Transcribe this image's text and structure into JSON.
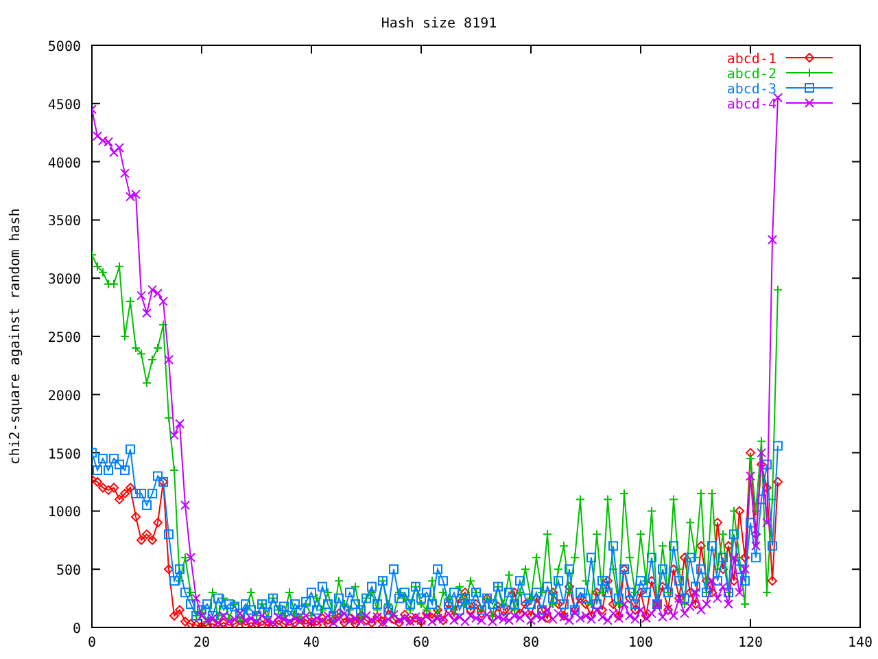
{
  "chart_data": {
    "type": "line",
    "title": "Hash size 8191",
    "ylabel": "chi2-square against random hash",
    "xlim": [
      0,
      140
    ],
    "ylim": [
      0,
      5000
    ],
    "xticks": [
      0,
      20,
      40,
      60,
      80,
      100,
      120,
      140
    ],
    "legend": true,
    "x": [
      0,
      1,
      2,
      3,
      4,
      5,
      6,
      7,
      8,
      9,
      10,
      11,
      12,
      13,
      14,
      15,
      16,
      17,
      18,
      19,
      20,
      21,
      22,
      23,
      24,
      25,
      26,
      27,
      28,
      29,
      30,
      31,
      32,
      33,
      34,
      35,
      36,
      37,
      38,
      39,
      40,
      41,
      42,
      43,
      44,
      45,
      46,
      47,
      48,
      49,
      50,
      51,
      52,
      53,
      54,
      55,
      56,
      57,
      58,
      59,
      60,
      61,
      62,
      63,
      64,
      65,
      66,
      67,
      68,
      69,
      70,
      71,
      72,
      73,
      74,
      75,
      76,
      77,
      78,
      79,
      80,
      81,
      82,
      83,
      84,
      85,
      86,
      87,
      88,
      89,
      90,
      91,
      92,
      93,
      94,
      95,
      96,
      97,
      98,
      99,
      100,
      101,
      102,
      103,
      104,
      105,
      106,
      107,
      108,
      109,
      110,
      111,
      112,
      113,
      114,
      115,
      116,
      117,
      118,
      119,
      120,
      121,
      122,
      123,
      124,
      125
    ],
    "yticks": [
      0,
      500,
      1000,
      1500,
      2000,
      2500,
      3000,
      3500,
      4000,
      4500,
      5000
    ],
    "series": [
      {
        "name": "abcd-1",
        "color": "#ff0000",
        "marker": "diamond",
        "values": [
          1270,
          1250,
          1200,
          1180,
          1200,
          1100,
          1150,
          1200,
          950,
          750,
          800,
          750,
          900,
          1250,
          500,
          100,
          150,
          50,
          30,
          20,
          10,
          20,
          30,
          10,
          40,
          20,
          30,
          60,
          20,
          40,
          30,
          20,
          50,
          10,
          60,
          30,
          20,
          40,
          70,
          30,
          50,
          20,
          80,
          30,
          60,
          120,
          40,
          80,
          30,
          100,
          60,
          40,
          90,
          50,
          150,
          70,
          40,
          110,
          60,
          80,
          50,
          120,
          80,
          150,
          60,
          200,
          100,
          250,
          300,
          150,
          200,
          120,
          250,
          80,
          180,
          100,
          150,
          300,
          120,
          200,
          100,
          250,
          150,
          80,
          300,
          200,
          100,
          350,
          150,
          250,
          200,
          100,
          300,
          150,
          400,
          200,
          100,
          500,
          250,
          150,
          300,
          100,
          400,
          200,
          350,
          150,
          500,
          250,
          600,
          300,
          200,
          700,
          400,
          300,
          900,
          500,
          700,
          400,
          1000,
          600,
          1500,
          800,
          1400,
          1200,
          400,
          1250
        ]
      },
      {
        "name": "abcd-2",
        "color": "#00c000",
        "marker": "plus",
        "values": [
          3200,
          3100,
          3050,
          2950,
          2950,
          3100,
          2500,
          2800,
          2400,
          2350,
          2100,
          2300,
          2400,
          2600,
          1800,
          1350,
          400,
          600,
          300,
          100,
          150,
          50,
          300,
          100,
          250,
          80,
          200,
          60,
          150,
          300,
          100,
          200,
          80,
          250,
          150,
          100,
          300,
          120,
          80,
          200,
          100,
          250,
          150,
          300,
          100,
          400,
          200,
          150,
          350,
          100,
          250,
          300,
          150,
          400,
          200,
          100,
          300,
          250,
          150,
          350,
          200,
          150,
          400,
          100,
          300,
          250,
          150,
          350,
          200,
          400,
          300,
          150,
          250,
          100,
          350,
          200,
          450,
          150,
          300,
          500,
          250,
          600,
          300,
          800,
          200,
          500,
          700,
          300,
          600,
          1100,
          400,
          200,
          800,
          300,
          1100,
          500,
          200,
          1150,
          600,
          300,
          800,
          400,
          1000,
          200,
          700,
          300,
          1100,
          500,
          200,
          900,
          600,
          1150,
          300,
          1150,
          500,
          800,
          300,
          1000,
          600,
          200,
          1450,
          1000,
          1600,
          300,
          1100,
          2900
        ]
      },
      {
        "name": "abcd-3",
        "color": "#0080ff",
        "marker": "square",
        "values": [
          1500,
          1350,
          1450,
          1350,
          1450,
          1400,
          1350,
          1530,
          1150,
          1150,
          1050,
          1150,
          1300,
          1250,
          800,
          400,
          500,
          300,
          200,
          100,
          150,
          200,
          100,
          250,
          150,
          200,
          180,
          120,
          200,
          150,
          100,
          200,
          130,
          250,
          150,
          180,
          100,
          200,
          150,
          220,
          300,
          150,
          350,
          200,
          100,
          250,
          150,
          300,
          200,
          150,
          250,
          350,
          200,
          400,
          150,
          500,
          250,
          300,
          200,
          350,
          250,
          300,
          200,
          500,
          400,
          200,
          300,
          150,
          250,
          200,
          300,
          150,
          250,
          200,
          350,
          150,
          300,
          200,
          400,
          250,
          200,
          300,
          150,
          350,
          250,
          400,
          200,
          500,
          150,
          300,
          250,
          600,
          200,
          400,
          300,
          700,
          250,
          500,
          300,
          200,
          400,
          300,
          600,
          200,
          500,
          300,
          700,
          400,
          250,
          600,
          350,
          500,
          300,
          700,
          400,
          600,
          300,
          800,
          500,
          400,
          900,
          600,
          1100,
          1400,
          700,
          1560
        ]
      },
      {
        "name": "abcd-4",
        "color": "#c000ff",
        "marker": "cross",
        "values": [
          4450,
          4220,
          4180,
          4170,
          4080,
          4120,
          3900,
          3700,
          3720,
          2850,
          2700,
          2900,
          2870,
          2800,
          2300,
          1650,
          1750,
          1050,
          600,
          250,
          100,
          60,
          80,
          40,
          100,
          50,
          70,
          120,
          60,
          80,
          50,
          100,
          60,
          40,
          90,
          70,
          50,
          80,
          60,
          100,
          50,
          80,
          60,
          100,
          40,
          70,
          120,
          60,
          80,
          50,
          100,
          60,
          90,
          40,
          70,
          110,
          60,
          80,
          50,
          90,
          60,
          100,
          50,
          80,
          70,
          120,
          60,
          90,
          50,
          100,
          80,
          60,
          110,
          50,
          90,
          70,
          60,
          100,
          80,
          120,
          60,
          100,
          80,
          150,
          70,
          120,
          90,
          60,
          130,
          80,
          100,
          70,
          150,
          90,
          60,
          120,
          80,
          200,
          100,
          70,
          150,
          80,
          120,
          200,
          90,
          160,
          100,
          250,
          120,
          180,
          300,
          150,
          200,
          400,
          250,
          350,
          200,
          600,
          300,
          500,
          1300,
          700,
          1500,
          900,
          3330,
          4550
        ]
      }
    ]
  }
}
